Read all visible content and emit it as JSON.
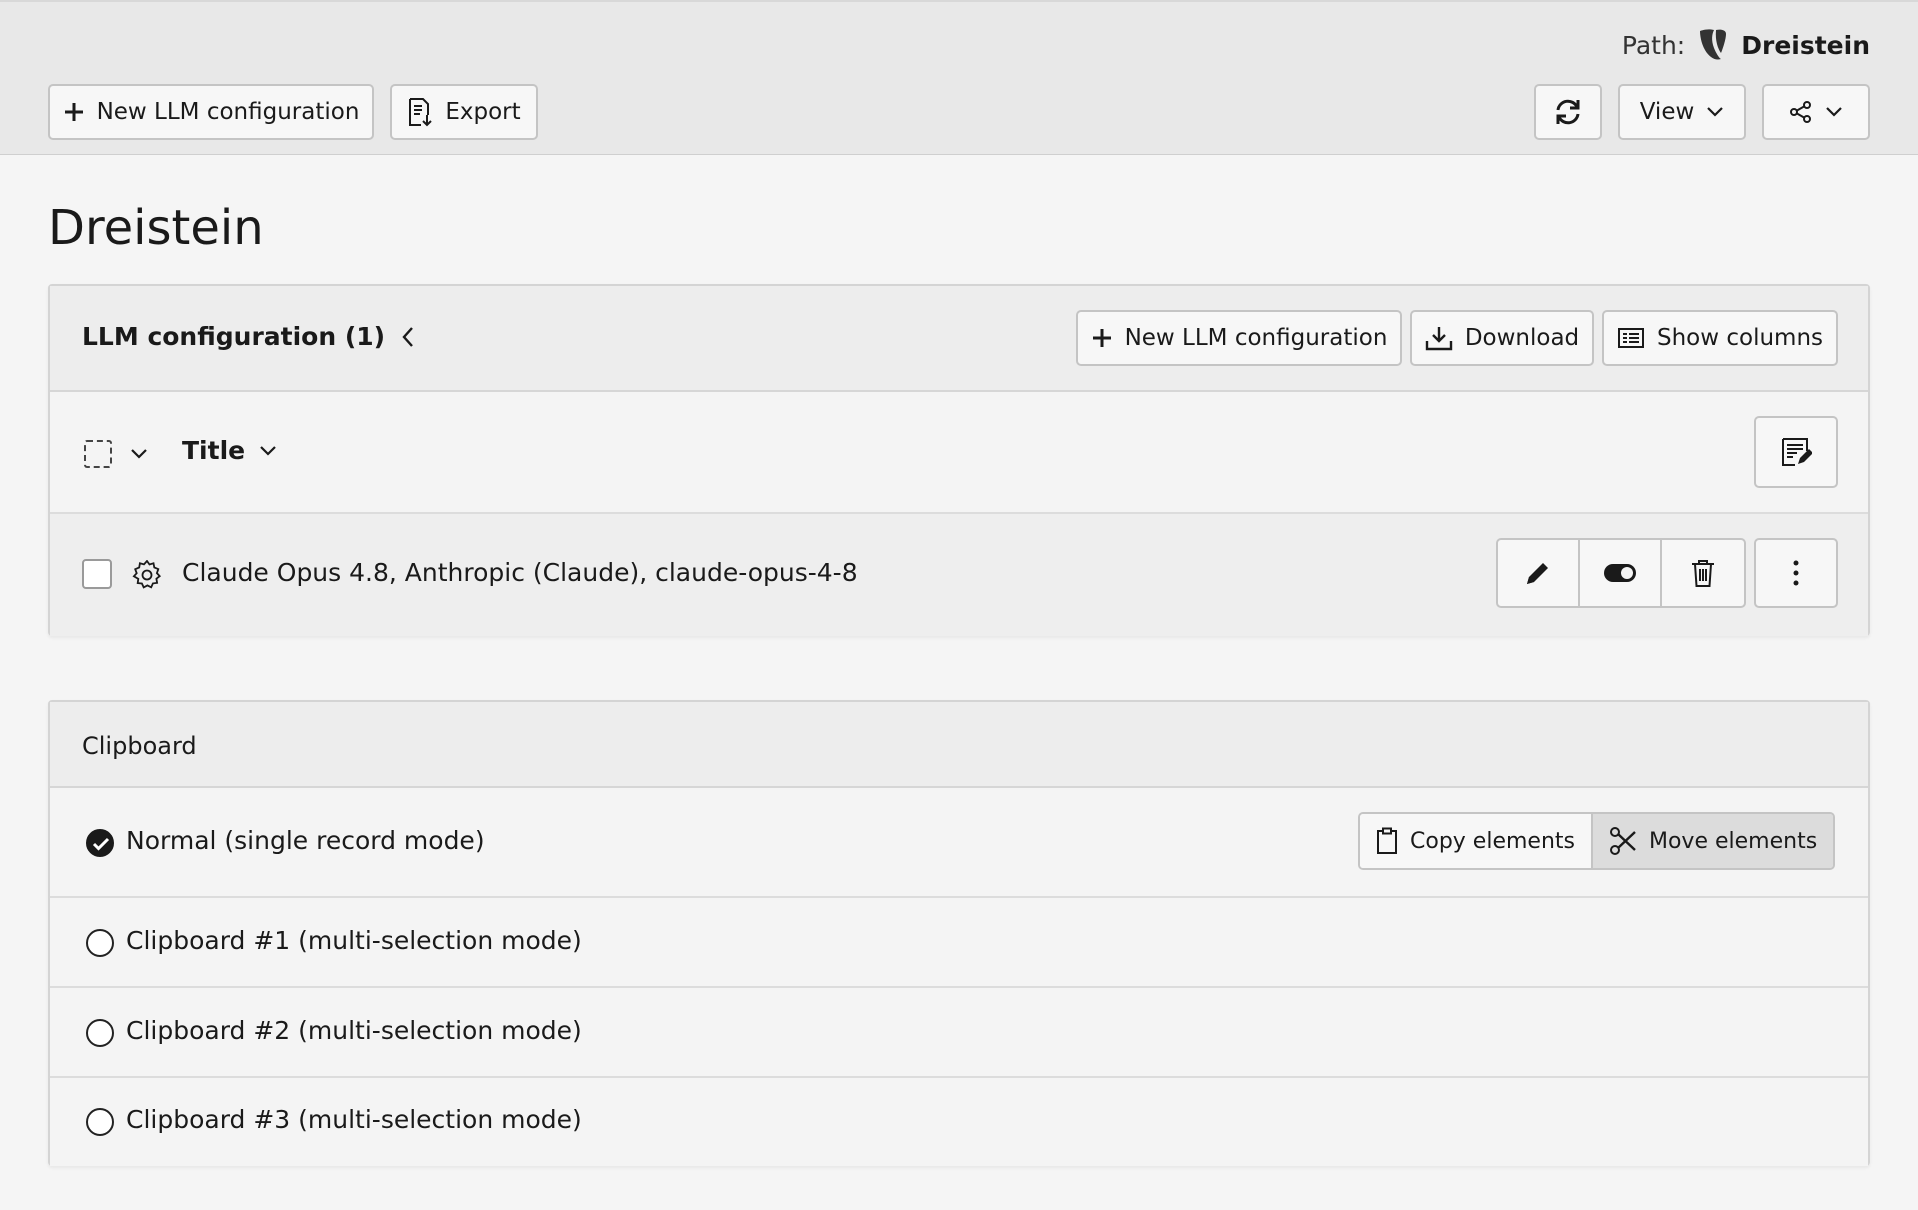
{
  "docheader": {
    "path_label": "Path:",
    "path_page": "Dreistein",
    "new_button": "New LLM configuration",
    "export_button": "Export",
    "view_button": "View"
  },
  "page": {
    "title": "Dreistein"
  },
  "llm_panel": {
    "title": "LLM configuration (1)",
    "new_button": "New LLM configuration",
    "download_button": "Download",
    "show_columns_button": "Show columns",
    "column_title": "Title",
    "rows": [
      {
        "title": "Claude Opus 4.8, Anthropic (Claude), claude-opus-4-8"
      }
    ]
  },
  "clipboard": {
    "title": "Clipboard",
    "copy_button": "Copy elements",
    "move_button": "Move elements",
    "modes": [
      {
        "label": "Normal (single record mode)",
        "selected": true
      },
      {
        "label": "Clipboard #1 (multi-selection mode)",
        "selected": false
      },
      {
        "label": "Clipboard #2 (multi-selection mode)",
        "selected": false
      },
      {
        "label": "Clipboard #3 (multi-selection mode)",
        "selected": false
      }
    ]
  },
  "icons": {
    "typo3": "typo3-logo-icon",
    "plus": "plus-icon",
    "export": "export-icon",
    "refresh": "refresh-icon",
    "chevron": "chevron-down-icon",
    "share": "share-icon",
    "collapse": "chevron-left-icon",
    "download": "download-icon",
    "columns": "columns-icon",
    "multi_edit": "multi-edit-icon",
    "record": "gear-icon",
    "edit": "pencil-icon",
    "toggle": "toggle-icon",
    "delete": "trash-icon",
    "more": "more-vertical-icon",
    "copy": "clipboard-icon",
    "cut": "scissors-icon",
    "check": "check-icon"
  },
  "colors": {
    "header_bg": "#e8e8e8",
    "page_bg": "#f5f5f5",
    "text": "#1a1a1a",
    "typo3_orange": "#f49700"
  }
}
